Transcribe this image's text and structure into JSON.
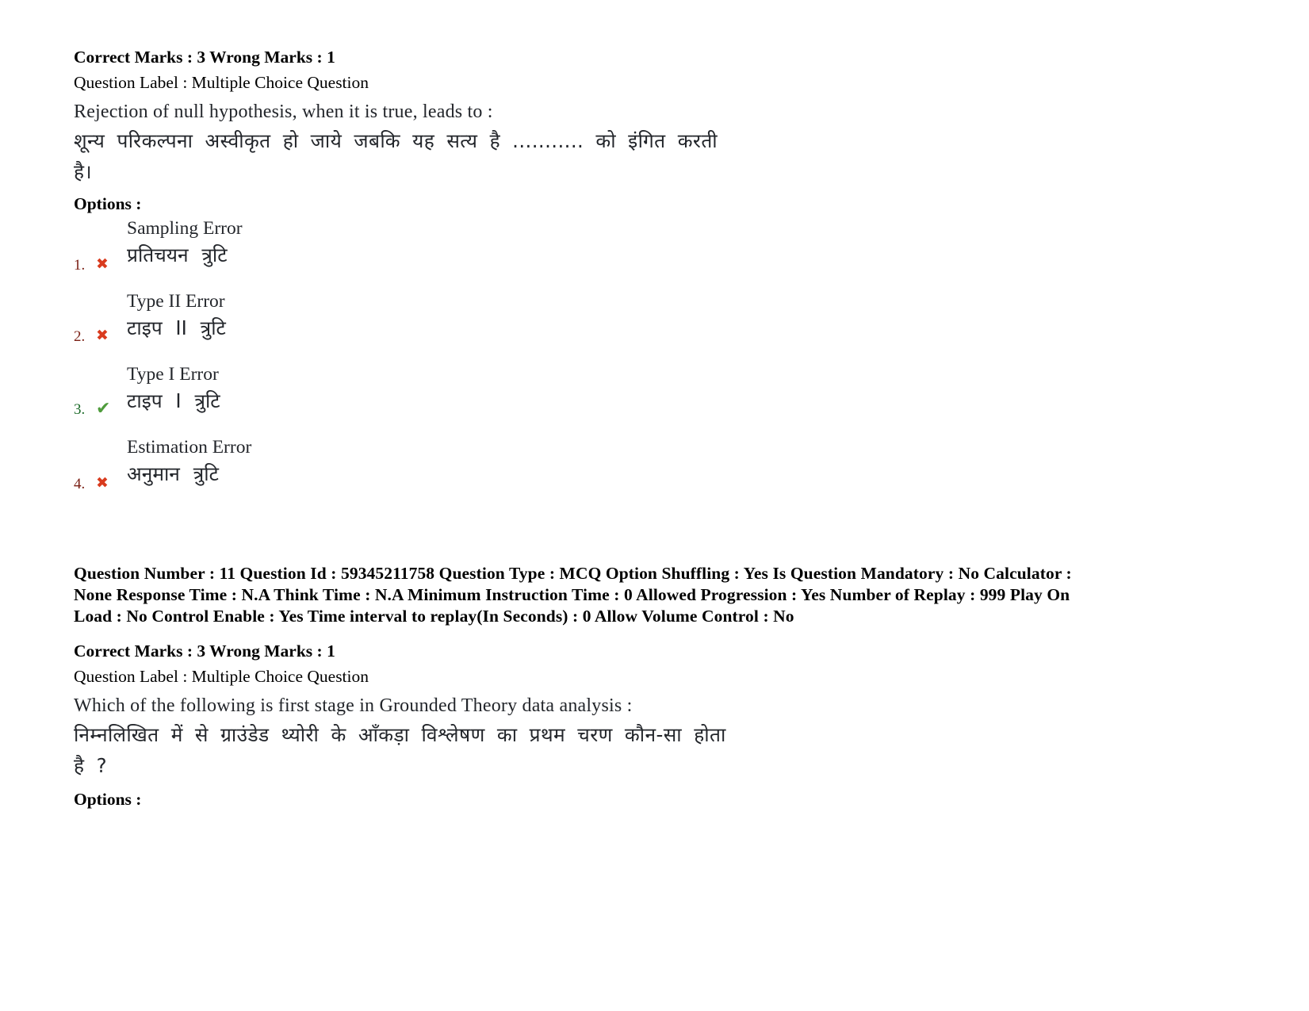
{
  "document": {
    "type": "exam-answer-key-page"
  },
  "question_10": {
    "marks_line": "Correct Marks : 3 Wrong Marks : 1",
    "question_label_line": "Question Label : Multiple Choice Question",
    "question_text_en": "Rejection of null hypothesis, when it is true, leads to :",
    "question_text_hi_line1": "शून्य परिकल्पना अस्वीकृत हो जाये जबकि यह सत्य है ........... को इंगित करती",
    "question_text_hi_line2": "है।",
    "options_label": "Options :",
    "options": [
      {
        "number": "1.",
        "marker": "wrong",
        "marker_glyph": "✖",
        "text_en": "Sampling Error",
        "text_hi": "प्रतिचयन त्रुटि"
      },
      {
        "number": "2.",
        "marker": "wrong",
        "marker_glyph": "✖",
        "text_en": "Type II Error",
        "text_hi": "टाइप II त्रुटि"
      },
      {
        "number": "3.",
        "marker": "right",
        "marker_glyph": "✔",
        "text_en": "Type I Error",
        "text_hi": "टाइप I त्रुटि"
      },
      {
        "number": "4.",
        "marker": "wrong",
        "marker_glyph": "✖",
        "text_en": "Estimation Error",
        "text_hi": "अनुमान त्रुटि"
      }
    ]
  },
  "question_11": {
    "meta_line1": "Question Number : 11 Question Id : 59345211758 Question Type : MCQ Option Shuffling : Yes Is Question Mandatory : No Calculator :",
    "meta_line2": "None Response Time : N.A Think Time : N.A Minimum Instruction Time : 0 Allowed Progression : Yes Number of Replay : 999 Play On",
    "meta_line3": "Load : No Control Enable : Yes Time interval to replay(In Seconds) : 0 Allow Volume Control : No",
    "marks_line": "Correct Marks : 3 Wrong Marks : 1",
    "question_label_line": "Question Label : Multiple Choice Question",
    "question_text_en": "Which of the following is first stage in Grounded Theory data analysis :",
    "question_text_hi_line1": "निम्नलिखित में से ग्राउंडेड थ्योरी के आँकड़ा विश्लेषण का प्रथम चरण कौन-सा होता",
    "question_text_hi_line2": "है ?",
    "options_label": "Options :"
  },
  "colors": {
    "wrong_marker": "#d93b1e",
    "right_marker": "#4f9c3c",
    "wrong_number": "#7a1f14",
    "right_number": "#1d6b2a",
    "body_text": "#000000",
    "scan_text": "#23262b"
  }
}
